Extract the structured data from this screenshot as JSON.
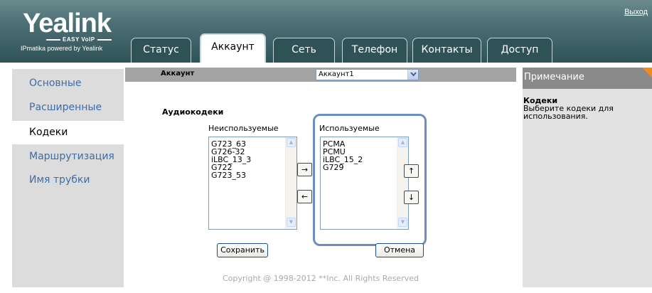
{
  "header": {
    "logo": "Yealink",
    "logo_tagline": "EASY VoIP",
    "powered_by": "IPmatika powered by Yealink",
    "logout_label": "Выход"
  },
  "tabs": [
    {
      "label": "Статус"
    },
    {
      "label": "Аккаунт"
    },
    {
      "label": "Сеть"
    },
    {
      "label": "Телефон"
    },
    {
      "label": "Контакты"
    },
    {
      "label": "Доступ"
    }
  ],
  "active_tab": "Аккаунт",
  "sidebar": {
    "items": [
      {
        "label": "Основные"
      },
      {
        "label": "Расширенные"
      },
      {
        "label": "Кодеки"
      },
      {
        "label": "Маршрутизация"
      },
      {
        "label": "Имя трубки"
      }
    ],
    "active": "Кодеки"
  },
  "account_bar": {
    "label": "Аккаунт",
    "selected": "Аккаунт1"
  },
  "codecs": {
    "section_title": "Аудиокодеки",
    "unused_caption": "Неиспользуемые",
    "used_caption": "Используемые",
    "unused": [
      "G723_63",
      "G726-32",
      "iLBC_13_3",
      "G722",
      "G723_53"
    ],
    "used": [
      "PCMA",
      "PCMU",
      "iLBC_15_2",
      "G729"
    ],
    "move_right_symbol": "→",
    "move_left_symbol": "←",
    "move_up_symbol": "↑",
    "move_down_symbol": "↓",
    "scroll_up_symbol": "▲",
    "scroll_down_symbol": "▼",
    "save_label": "Сохранить",
    "cancel_label": "Отмена"
  },
  "note": {
    "title": "Примечание",
    "heading": "Кодеки",
    "text": "Выберите кодеки для использования.",
    "corner_color": "#f08a1e"
  },
  "footer": {
    "copyright": "Copyright @ 1998-2012 **Inc. All Rights Reserved"
  },
  "colors": {
    "header": "#3f6468",
    "link": "#3c6ea5",
    "frame_highlight": "#6d8fc0"
  }
}
